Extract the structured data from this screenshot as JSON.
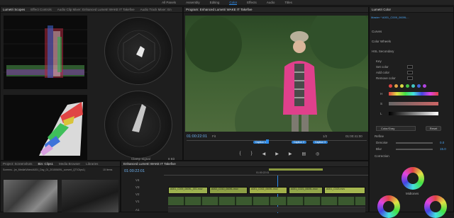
{
  "workspaces": [
    "All Panels",
    "Assembly",
    "Editing",
    "Color",
    "Effects",
    "Audio",
    "Titles"
  ],
  "active_workspace": "Color",
  "top_left_tabs": [
    "Lumetri Scopes",
    "Effect Controls",
    "Audio Clip Mixer: Enhanced Lumetri WAKE IT Takefive",
    "Audio Track Mixer: En"
  ],
  "scope": {
    "signal_label": "Clamp Signal",
    "bit_label": "8 Bit"
  },
  "program": {
    "tab": "Program: Enhanced Lumetri WAKE IT Takefive",
    "timecode": "01:00:22:01",
    "fit": "Fit",
    "fraction": "1/2",
    "duration": "01:00:41:00",
    "markers": [
      "Caption 1",
      "Caption 2",
      "Caption 3"
    ]
  },
  "lumetri": {
    "tabs": [
      "Lumetri Color",
      "Enhanced Lumetri..."
    ],
    "master_label": "Master * A001_C009_0609L...",
    "sections": [
      "Curves",
      "Color Wheels",
      "HSL Secondary"
    ],
    "key_label": "Key",
    "key_rows": [
      "Set color",
      "Add color",
      "Remove color"
    ],
    "hsl": [
      "H",
      "S",
      "L"
    ],
    "color_gray": "Color/Gray",
    "reset": "Reset",
    "refine": "Refine",
    "denoise": {
      "label": "Denoise",
      "value": "0.0"
    },
    "blur": {
      "label": "Blur",
      "value": "15.0"
    },
    "correction": "Correction",
    "midtones": "Midtones",
    "colors": {
      "accent": "#2d8ceb"
    }
  },
  "project": {
    "tabs": [
      "Project: Screenshots",
      "Bin: Clips1",
      "Media Browser",
      "Libraries"
    ],
    "path": "Screens...(m_Media\\Video\\A001_Day_01_20150609L_convert_QT\\Clips1)",
    "count": "15 Items"
  },
  "timeline": {
    "tab": "Enhanced Lumetri WAKE IT Takefive",
    "timecode": "01:00:22:01",
    "ruler_time": "01:00:22:01",
    "tracks": [
      "V4",
      "V3",
      "V2",
      "V1",
      "A1"
    ],
    "clips": [
      {
        "label": "A001_C009_0609L_001.mov",
        "color": "#a2b04a"
      },
      {
        "label": "A002_C010_0609L.mov",
        "color": "#8d9f45"
      },
      {
        "label": "A001_C002_0609L.mov",
        "color": "#9db14f"
      },
      {
        "label": "A001_C021_0609L.mov",
        "color": "#92a54a"
      },
      {
        "label": "A001_C023.mov",
        "color": "#a6b850"
      }
    ]
  }
}
